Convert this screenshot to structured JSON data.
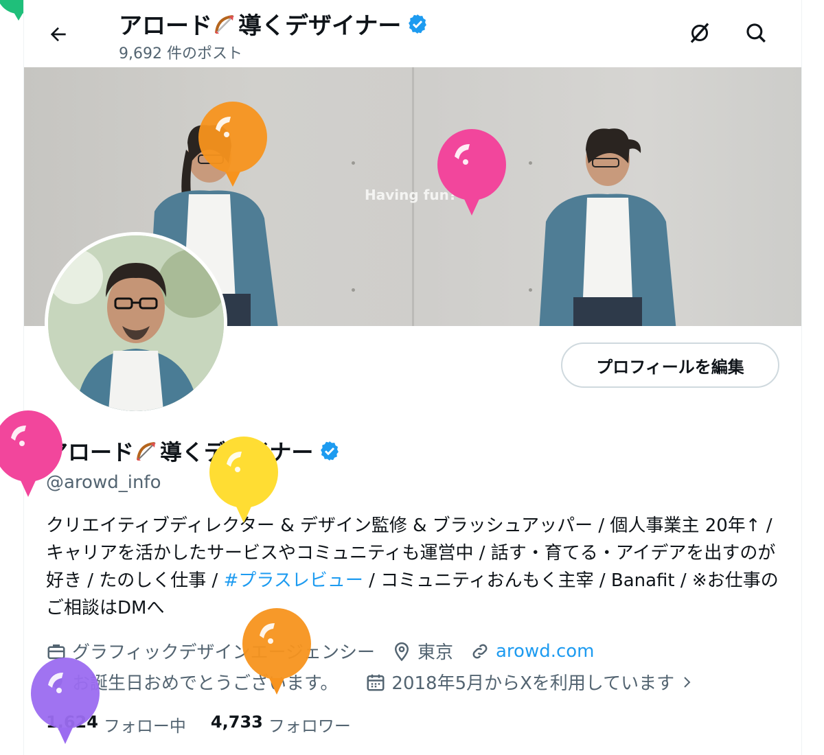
{
  "header": {
    "name_prefix": "アロード",
    "name_suffix": "導くデザイナー",
    "post_count": "9,692 件のポスト"
  },
  "banner": {
    "overlay_text": "Having fun?"
  },
  "profile": {
    "edit_button": "プロフィールを編集",
    "name_prefix": "アロード",
    "name_suffix": "導くデザイナー",
    "handle": "@arowd_info",
    "bio_part1": "クリエイティブディレクター & デザイン監修 & ブラッシュアッパー  / 個人事業主 20年↑ / キャリアを活かしたサービスやコミュニティも運営中 / 話す・育てる・アイデアを出すのが好き / たのしく仕事 / ",
    "bio_hashtag": "#プラスレビュー",
    "bio_part2": " / コミュニティおんもく主宰 / Banafit / ※お仕事のご相談はDMへ",
    "category": "グラフィックデザインエージェンシー",
    "location": "東京",
    "website": "arowd.com",
    "birthday": "お誕生日おめでとうございます。",
    "joined": "2018年5月からXを利用しています",
    "following_count": "1,624",
    "following_label": "フォロー中",
    "followers_count": "4,733",
    "followers_label": "フォロワー"
  },
  "icons": {
    "back": "arrow-left-icon",
    "grok": "grok-icon",
    "search": "search-icon",
    "verified": "verified-badge-icon",
    "bow": "bow-and-arrow-emoji",
    "briefcase": "briefcase-icon",
    "location": "location-pin-icon",
    "link": "link-icon",
    "balloon": "balloon-icon",
    "calendar": "calendar-icon",
    "chevron": "chevron-right-icon"
  },
  "colors": {
    "accent": "#1d9bf0",
    "muted_text": "#536471",
    "balloon_orange": "#f7931e",
    "balloon_pink": "#f2469c",
    "balloon_yellow": "#ffdd33",
    "balloon_purple": "#9b6cf0",
    "balloon_green": "#1fbf7a"
  }
}
